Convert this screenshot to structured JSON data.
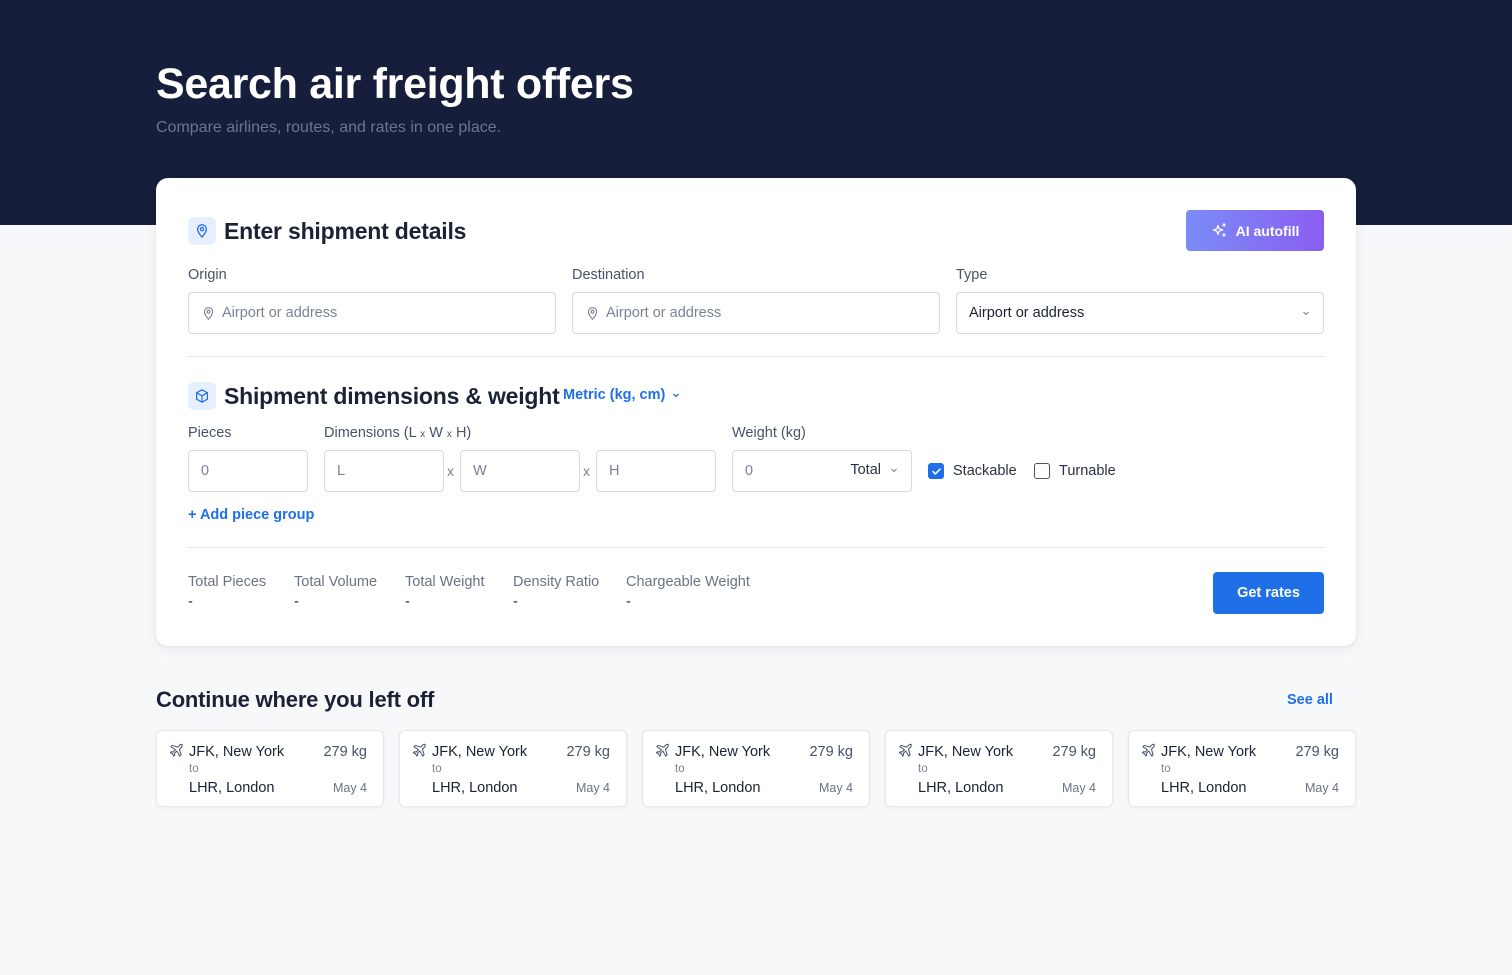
{
  "hero": {
    "title": "Search air freight offers",
    "subtitle": "Compare airlines, routes, and rates in one place."
  },
  "shipment": {
    "title": "Enter shipment details",
    "ai_button": "AI autofill",
    "origin": {
      "label": "Origin",
      "placeholder": "Airport or address"
    },
    "destination": {
      "label": "Destination",
      "placeholder": "Airport or address"
    },
    "type": {
      "label": "Type",
      "value": "Airport or address"
    }
  },
  "dimensions": {
    "title": "Shipment dimensions & weight",
    "unit_select": "Metric (kg, cm)",
    "pieces": {
      "label": "Pieces",
      "placeholder": "0"
    },
    "dims": {
      "label_main": "Dimensions (L ",
      "x1": "x",
      "w": " W ",
      "x2": "x",
      "h": " H)",
      "l_ph": "L",
      "w_ph": "W",
      "h_ph": "H",
      "sep": "x"
    },
    "weight": {
      "label": "Weight (kg)",
      "placeholder": "0",
      "mode": "Total"
    },
    "stackable": {
      "label": "Stackable",
      "checked": true
    },
    "turnable": {
      "label": "Turnable",
      "checked": false
    },
    "add_group": "+ Add piece group"
  },
  "summary": {
    "stats": [
      {
        "label": "Total Pieces",
        "value": "-"
      },
      {
        "label": "Total Volume",
        "value": "-"
      },
      {
        "label": "Total Weight",
        "value": "-"
      },
      {
        "label": "Density Ratio",
        "value": "-"
      },
      {
        "label": "Chargeable Weight",
        "value": "-"
      }
    ],
    "get_rates": "Get rates"
  },
  "recent": {
    "title": "Continue where you left off",
    "see_all": "See all",
    "items": [
      {
        "from": "JFK, New York",
        "to_word": "to",
        "dest": "LHR, London",
        "weight": "279 kg",
        "date": "May 4"
      },
      {
        "from": "JFK, New York",
        "to_word": "to",
        "dest": "LHR, London",
        "weight": "279 kg",
        "date": "May 4"
      },
      {
        "from": "JFK, New York",
        "to_word": "to",
        "dest": "LHR, London",
        "weight": "279 kg",
        "date": "May 4"
      },
      {
        "from": "JFK, New York",
        "to_word": "to",
        "dest": "LHR, London",
        "weight": "279 kg",
        "date": "May 4"
      },
      {
        "from": "JFK, New York",
        "to_word": "to",
        "dest": "LHR, London",
        "weight": "279 kg",
        "date": "May 4"
      }
    ]
  },
  "colors": {
    "hero_bg": "#161e3c",
    "accent": "#1f6fe6",
    "ai_gradient_start": "#7a8cf7",
    "ai_gradient_end": "#8a5ef0"
  },
  "icons": [
    "map-pin-icon",
    "sparkles-icon",
    "box-icon",
    "chevron-down-icon",
    "checkmark-icon",
    "plane-icon"
  ]
}
